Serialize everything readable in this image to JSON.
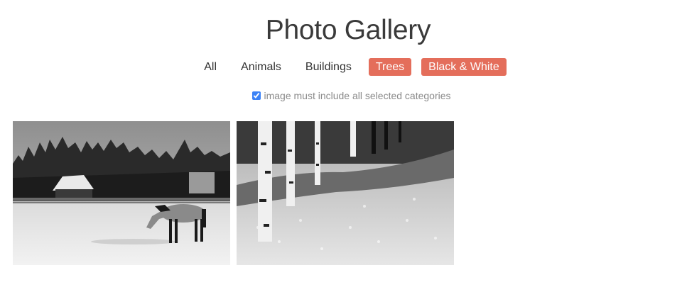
{
  "title": "Photo Gallery",
  "filters": [
    {
      "label": "All",
      "active": false
    },
    {
      "label": "Animals",
      "active": false
    },
    {
      "label": "Buildings",
      "active": false
    },
    {
      "label": "Trees",
      "active": true
    },
    {
      "label": "Black & White",
      "active": true
    }
  ],
  "match_all": {
    "label": "image must include all selected categories",
    "checked": true
  },
  "colors": {
    "accent": "#e46e5b",
    "checkbox": "#3b82f6",
    "muted_text": "#8a8a8a"
  },
  "photos": [
    {
      "subject": "horse-in-snowy-field"
    },
    {
      "subject": "birch-trees-meadow"
    }
  ]
}
